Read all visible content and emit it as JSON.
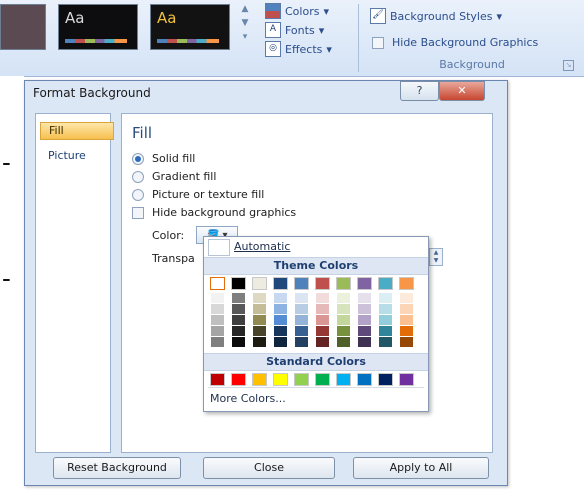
{
  "ribbon": {
    "themes": [
      {
        "label": "Aa",
        "text_color": "#d9d9d9"
      },
      {
        "label": "Aa",
        "text_color": "#f0c040"
      }
    ],
    "colors_label": "Colors",
    "fonts_label": "Fonts",
    "effects_label": "Effects",
    "background_styles_label": "Background Styles",
    "hide_bg_graphics_label": "Hide Background Graphics",
    "group_label": "Background",
    "dropdown_arrow": "▾"
  },
  "dialog": {
    "title": "Format Background",
    "help_label": "?",
    "close_label": "✕",
    "nav": [
      {
        "label": "Fill",
        "selected": true
      },
      {
        "label": "Picture",
        "selected": false
      }
    ],
    "fill_heading": "Fill",
    "options": [
      {
        "label": "Solid fill",
        "type": "radio",
        "checked": true
      },
      {
        "label": "Gradient fill",
        "type": "radio",
        "checked": false
      },
      {
        "label": "Picture or texture fill",
        "type": "radio",
        "checked": false
      },
      {
        "label": "Hide background graphics",
        "type": "checkbox",
        "checked": false
      }
    ],
    "color_label": "Color:",
    "transparency_label": "Transpa",
    "buttons": {
      "reset": "Reset Background",
      "close": "Close",
      "apply_all": "Apply to All"
    }
  },
  "color_popup": {
    "automatic_label": "Automatic",
    "theme_header": "Theme Colors",
    "standard_header": "Standard Colors",
    "more_colors_label": "More Colors...",
    "theme_colors": [
      {
        "name": "White",
        "base": "#ffffff",
        "shades": [
          "#f2f2f2",
          "#d8d8d8",
          "#bfbfbf",
          "#a5a5a5",
          "#7f7f7f"
        ]
      },
      {
        "name": "Black",
        "base": "#000000",
        "shades": [
          "#7f7f7f",
          "#595959",
          "#3f3f3f",
          "#262626",
          "#0c0c0c"
        ]
      },
      {
        "name": "Tan",
        "base": "#eeece1",
        "shades": [
          "#ddd9c3",
          "#c4bd97",
          "#938953",
          "#494429",
          "#1d1b10"
        ]
      },
      {
        "name": "Dark Blue",
        "base": "#1f497d",
        "shades": [
          "#c6d9f0",
          "#8db3e2",
          "#548dd4",
          "#17365d",
          "#0f243e"
        ]
      },
      {
        "name": "Blue",
        "base": "#4f81bd",
        "shades": [
          "#dbe5f1",
          "#b8cce4",
          "#95b3d7",
          "#366092",
          "#244061"
        ]
      },
      {
        "name": "Red",
        "base": "#c0504d",
        "shades": [
          "#f2dcdb",
          "#e5b9b7",
          "#d99694",
          "#953734",
          "#632423"
        ]
      },
      {
        "name": "Olive Green",
        "base": "#9bbb59",
        "shades": [
          "#ebf1dd",
          "#d7e3bc",
          "#c3d69b",
          "#76923c",
          "#4f6128"
        ]
      },
      {
        "name": "Purple",
        "base": "#8064a2",
        "shades": [
          "#e5e0ec",
          "#ccc1d9",
          "#b2a2c7",
          "#5f497a",
          "#3f3151"
        ]
      },
      {
        "name": "Aqua",
        "base": "#4bacc6",
        "shades": [
          "#dbeef3",
          "#b7dde8",
          "#92cddc",
          "#31859b",
          "#205867"
        ]
      },
      {
        "name": "Orange",
        "base": "#f79646",
        "shades": [
          "#fdeada",
          "#fbd5b5",
          "#fac08f",
          "#e36c09",
          "#974806"
        ]
      }
    ],
    "standard_colors": [
      "#c00000",
      "#ff0000",
      "#ffc000",
      "#ffff00",
      "#92d050",
      "#00b050",
      "#00b0f0",
      "#0070c0",
      "#002060",
      "#7030a0"
    ]
  }
}
